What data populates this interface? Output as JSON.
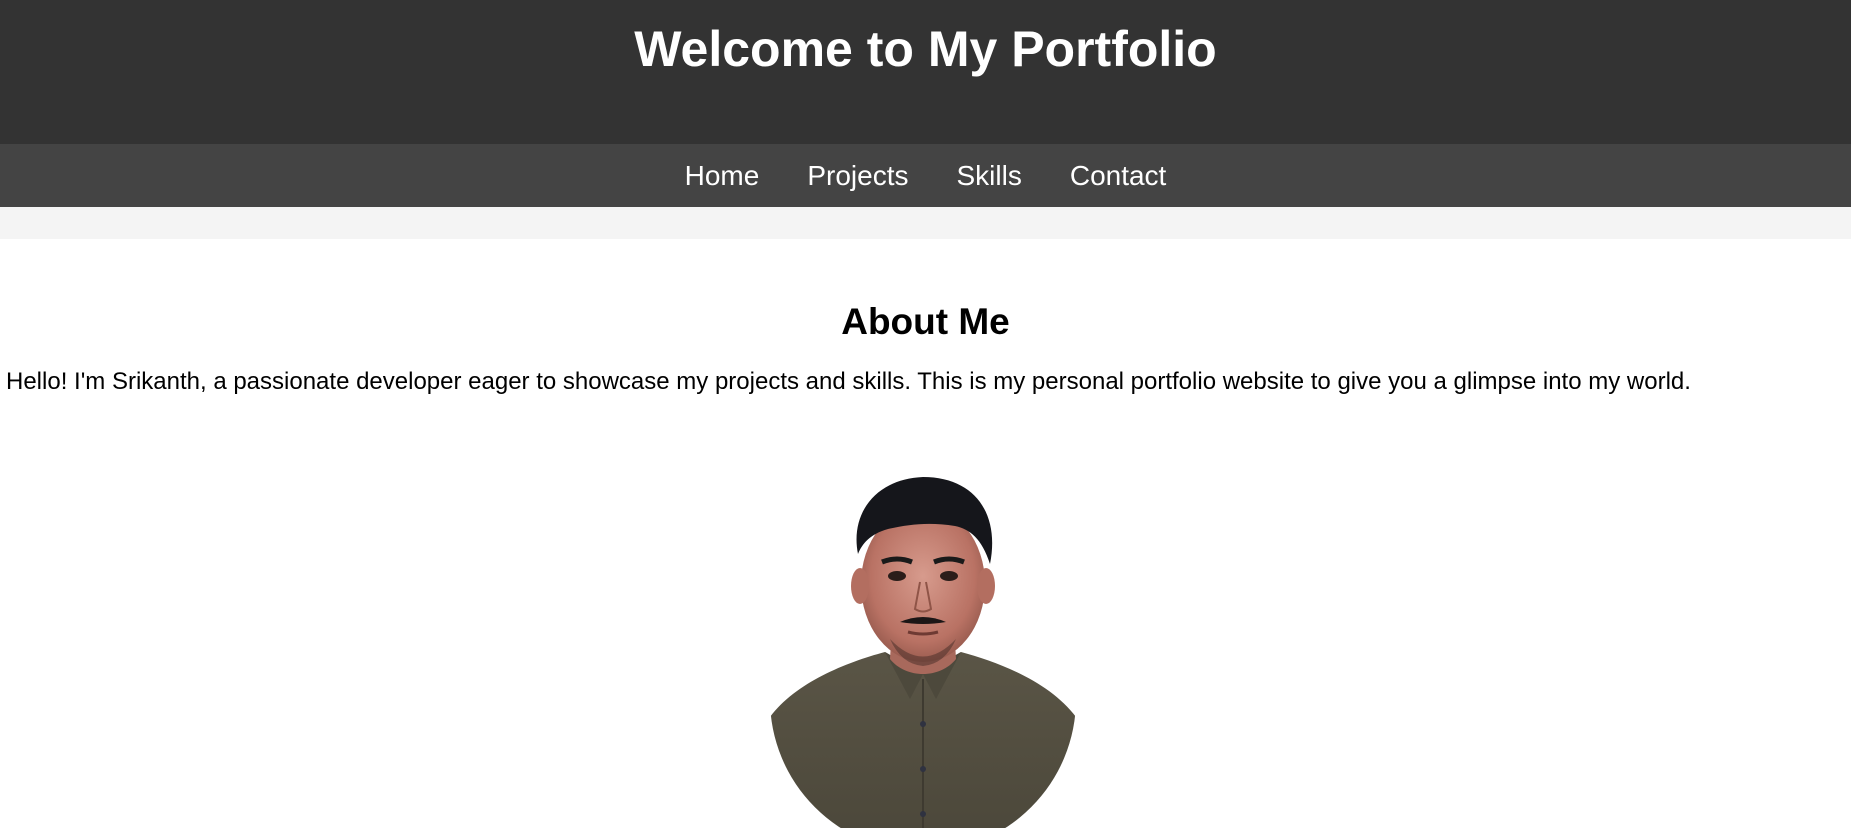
{
  "header": {
    "title": "Welcome to My Portfolio"
  },
  "nav": {
    "items": [
      {
        "label": "Home"
      },
      {
        "label": "Projects"
      },
      {
        "label": "Skills"
      },
      {
        "label": "Contact"
      }
    ]
  },
  "about": {
    "heading": "About Me",
    "text": "Hello! I'm Srikanth, a passionate developer eager to showcase my projects and skills. This is my personal portfolio website to give you a glimpse into my world."
  },
  "colors": {
    "header_bg": "#333333",
    "nav_bg": "#444444",
    "page_bg": "#f4f4f4",
    "content_bg": "#ffffff"
  },
  "icons": {
    "profile_photo": "profile-photo"
  }
}
